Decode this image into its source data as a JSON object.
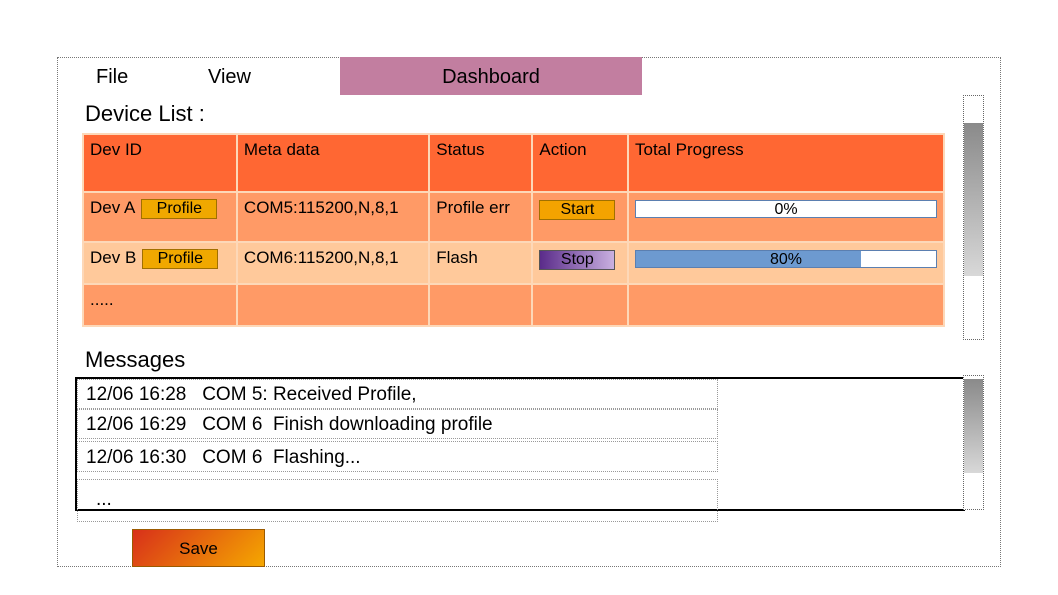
{
  "menu": {
    "file": "File",
    "view": "View",
    "dashboard": "Dashboard"
  },
  "device_list": {
    "title": "Device List :",
    "columns": [
      "Dev ID",
      "Meta data",
      "Status",
      "Action",
      "Total Progress"
    ],
    "rows": [
      {
        "dev_id": "Dev A",
        "profile_label": "Profile",
        "meta": "COM5:115200,N,8,1",
        "status": "Profile err",
        "action": "Start",
        "progress_label": "0%",
        "progress": 0
      },
      {
        "dev_id": "Dev B",
        "profile_label": "Profile",
        "meta": "COM6:115200,N,8,1",
        "status": "Flash",
        "action": "Stop",
        "progress_label": "80%",
        "progress": 0.75
      }
    ],
    "more": "....."
  },
  "messages": {
    "title": "Messages",
    "items": [
      "12/06 16:28   COM 5: Received Profile,",
      "12/06 16:29   COM 6  Finish downloading profile",
      "12/06 16:30   COM 6  Flashing..."
    ],
    "more": "..."
  },
  "save_label": "Save",
  "colors": {
    "dashboard_tab": "#c27ea0",
    "table_header": "#ff6733",
    "row_a": "#ff9a66",
    "row_b": "#ffc99b",
    "progress_fill": "#6d9ad0"
  }
}
